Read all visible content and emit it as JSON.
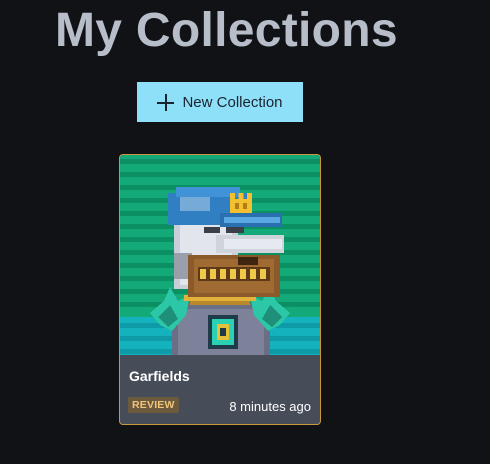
{
  "page": {
    "title": "My Collections"
  },
  "toolbar": {
    "new_collection_label": "New Collection",
    "new_collection_icon": "plus-icon"
  },
  "collections": [
    {
      "name": "Garfields",
      "status": "REVIEW",
      "updated": "8 minutes ago",
      "thumbnail": "pixel-art duck character wearing a blue cap with a crown emblem, gold grill and spiked jewelry on striped green background",
      "status_color": "#6b5a3c",
      "border_color": "#c69a3a"
    }
  ],
  "colors": {
    "background": "#111216",
    "title": "#b7bec9",
    "button": "#8ee0f9",
    "card_footer": "#464c58"
  }
}
